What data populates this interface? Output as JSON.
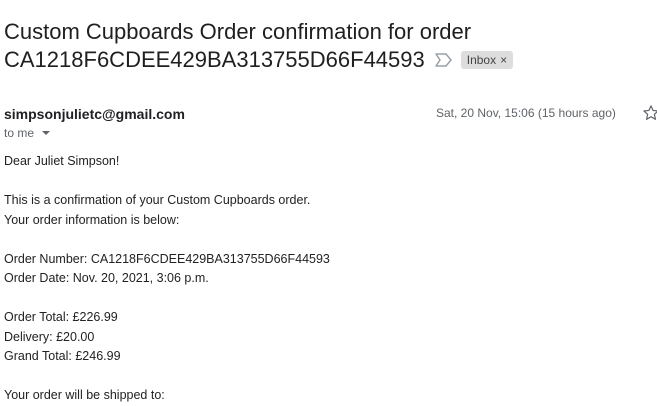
{
  "email": {
    "subject_line1": "Custom Cupboards Order confirmation for order",
    "subject_line2": "CA1218F6CDEE429BA313755D66F44593",
    "label": "Inbox",
    "label_close": "×",
    "sender": "simpsonjulietc@gmail.com",
    "date": "Sat, 20 Nov, 15:06 (15 hours ago)",
    "recipient": "to me",
    "body": {
      "greeting": "Dear Juliet Simpson!",
      "intro1": "This is a confirmation of your Custom Cupboards order.",
      "intro2": "Your order information is below:",
      "order_number": "Order Number: CA1218F6CDEE429BA313755D66F44593",
      "order_date": "Order Date: Nov. 20, 2021, 3:06 p.m.",
      "order_total": "Order Total: £226.99",
      "delivery": "Delivery: £20.00",
      "grand_total": "Grand Total: £246.99",
      "shipped_to": "Your order will be shipped to:"
    }
  },
  "icons": {
    "important": "important-marker-icon",
    "star": "star-icon",
    "caret": "chevron-down-icon"
  }
}
